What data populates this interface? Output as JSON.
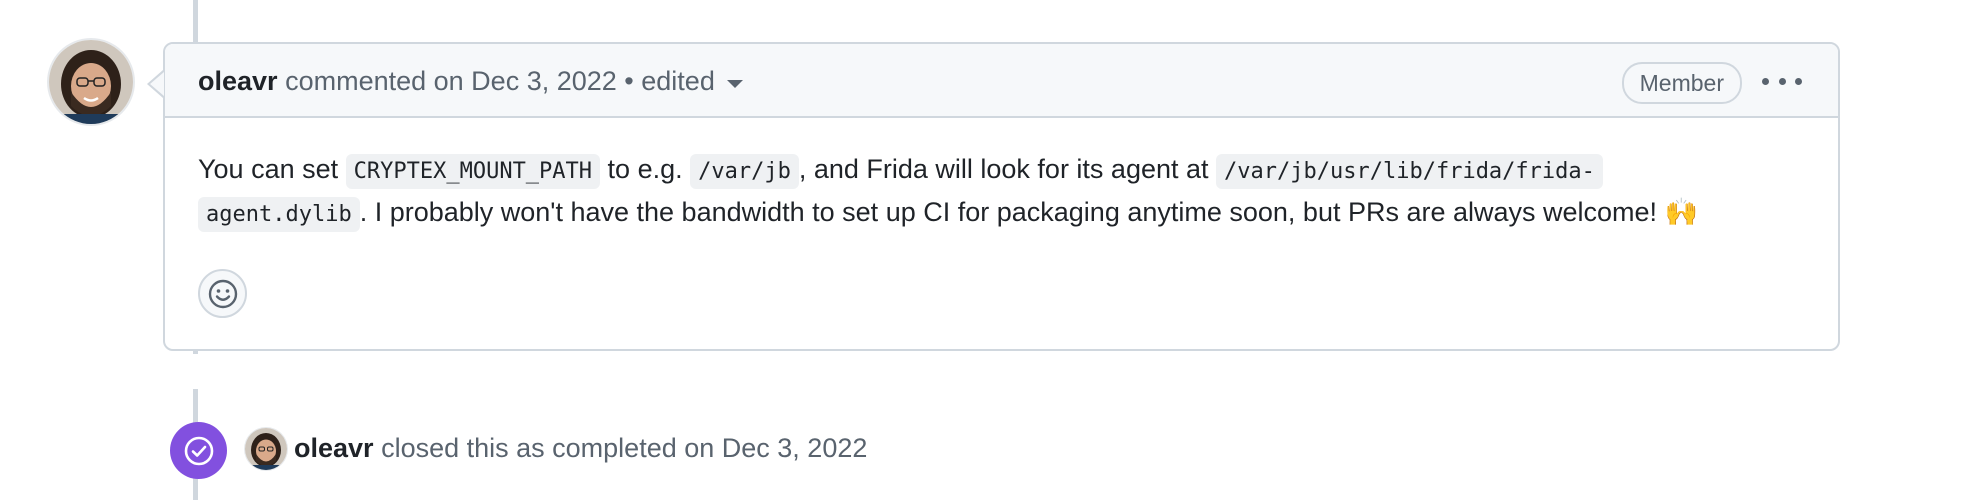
{
  "comment": {
    "author": "oleavr",
    "action_text": "commented on Dec 3, 2022",
    "separator": "•",
    "edited_label": "edited",
    "role_badge": "Member",
    "body": {
      "text_1": "You can set ",
      "code_1": "CRYPTEX_MOUNT_PATH",
      "text_2": " to e.g. ",
      "code_2": "/var/jb",
      "text_3": ", and Frida will look for its agent at ",
      "code_3a": "/var/jb/usr/lib/frida/frida-",
      "code_3b": "agent.dylib",
      "text_4": ". I probably won't have the bandwidth to set up CI for packaging anytime soon, but PRs are always welcome! ",
      "emoji": "🙌"
    },
    "icons": {
      "more": "kebab-horizontal-icon",
      "reaction": "smiley-icon"
    }
  },
  "event": {
    "author": "oleavr",
    "text": "closed this as completed on Dec 3, 2022",
    "icon": "check-circle-icon",
    "badge_color": "#8250df"
  },
  "colors": {
    "border": "#d0d7de",
    "header_bg": "#f6f8fa",
    "muted_text": "#59636e",
    "text": "#1f2328",
    "code_bg": "#eff1f3"
  }
}
